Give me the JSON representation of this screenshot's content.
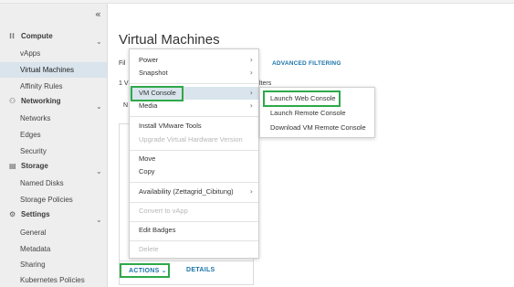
{
  "sidebar": {
    "collapse_icon": "«",
    "sections": [
      {
        "label": "Compute",
        "icon": "grid-icon"
      },
      {
        "label": "Networking",
        "icon": "network-icon"
      },
      {
        "label": "Storage",
        "icon": "storage-icon"
      },
      {
        "label": "Settings",
        "icon": "gear-icon"
      }
    ],
    "compute_items": [
      "vApps",
      "Virtual Machines",
      "Affinity Rules"
    ],
    "networking_items": [
      "Networks",
      "Edges",
      "Security"
    ],
    "storage_items": [
      "Named Disks",
      "Storage Policies"
    ],
    "settings_items": [
      "General",
      "Metadata",
      "Sharing",
      "Kubernetes Policies"
    ]
  },
  "main": {
    "title": "Virtual Machines",
    "filter_tab": "Fil",
    "advanced_filtering": "ADVANCED FILTERING",
    "count_text": "1 V",
    "filters_text": "lters",
    "column_label": "N",
    "actions_button": "ACTIONS",
    "details_button": "DETAILS"
  },
  "menu": {
    "power": "Power",
    "snapshot": "Snapshot",
    "vm_console": "VM Console",
    "media": "Media",
    "install_tools": "Install VMware Tools",
    "upgrade_hw": "Upgrade Virtual Hardware Version",
    "move": "Move",
    "copy": "Copy",
    "availability": "Availability (Zettagrid_Cibitung)",
    "convert": "Convert to vApp",
    "edit_badges": "Edit Badges",
    "delete": "Delete"
  },
  "submenu": {
    "launch_web": "Launch Web Console",
    "launch_remote": "Launch Remote Console",
    "download_remote": "Download VM Remote Console"
  },
  "colors": {
    "highlight_box": "#2ea84a",
    "link": "#1a73a8",
    "active_item": "#d9e4ec"
  }
}
